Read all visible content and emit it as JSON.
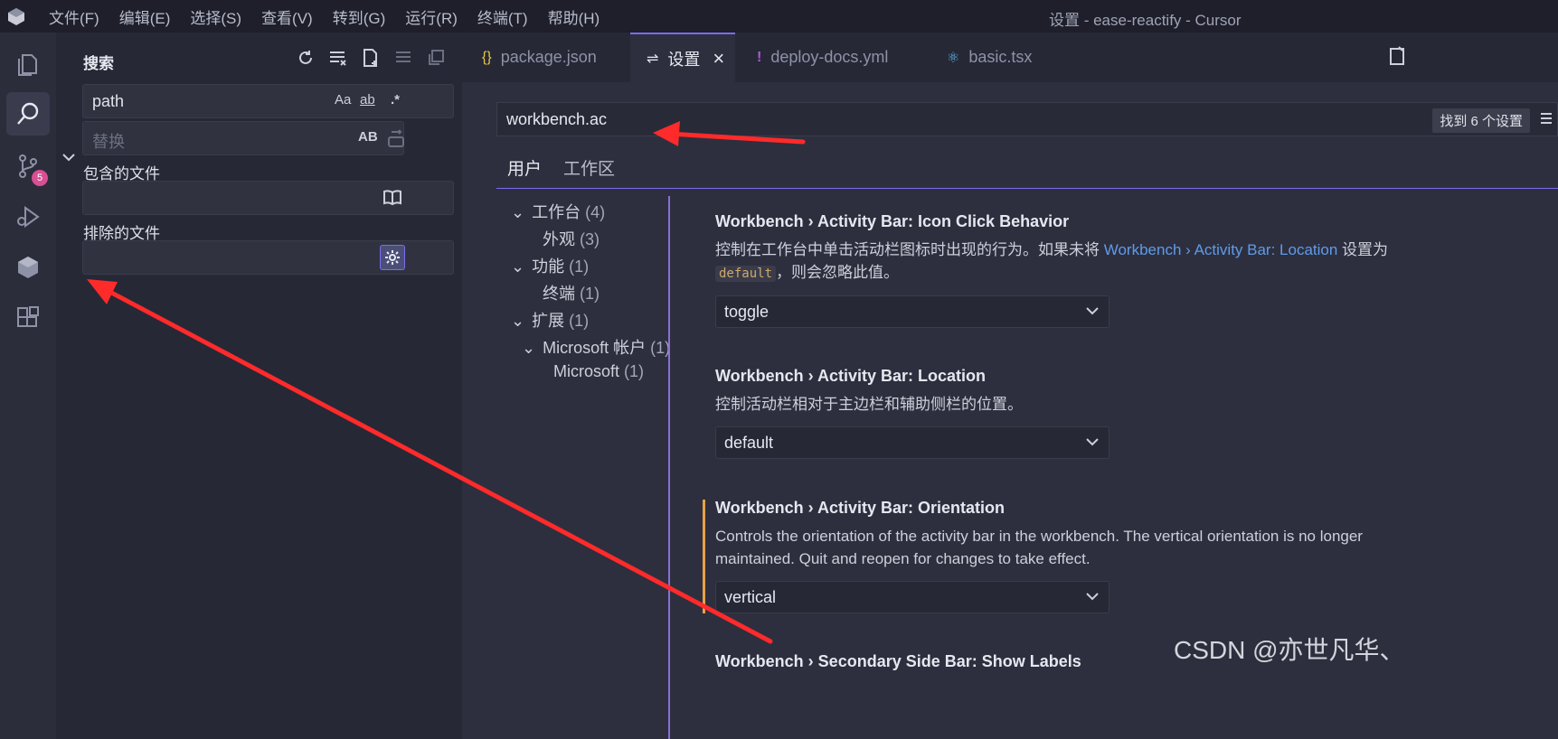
{
  "window": {
    "title": "设置 - ease-reactify - Cursor"
  },
  "menu": [
    "文件(F)",
    "编辑(E)",
    "选择(S)",
    "查看(V)",
    "转到(G)",
    "运行(R)",
    "终端(T)",
    "帮助(H)"
  ],
  "activity": {
    "scm_badge": "5"
  },
  "sidebar": {
    "title": "搜索",
    "search_value": "path",
    "opt_case": "Aa",
    "opt_word": "ab",
    "opt_regex": ".*",
    "replace_placeholder": "替换",
    "opt_preserve_case": "AB",
    "include_label": "包含的文件",
    "include_value": "",
    "exclude_label": "排除的文件",
    "exclude_value": "",
    "more": "···"
  },
  "tabs": [
    {
      "icon": "{}",
      "label": "package.json"
    },
    {
      "icon": "⇌",
      "label": "设置"
    },
    {
      "icon": "!",
      "label": "deploy-docs.yml"
    },
    {
      "icon": "⚛",
      "label": "basic.tsx"
    }
  ],
  "settings": {
    "search_value": "workbench.ac",
    "found": "找到 6 个设置",
    "scopes": [
      "用户",
      "工作区"
    ],
    "toc": [
      {
        "label": "工作台",
        "count": "(4)"
      },
      {
        "label": "外观",
        "count": "(3)"
      },
      {
        "label": "功能",
        "count": "(1)"
      },
      {
        "label": "终端",
        "count": "(1)"
      },
      {
        "label": "扩展",
        "count": "(1)"
      },
      {
        "label": "Microsoft 帐户",
        "count": "(1)"
      },
      {
        "label": "Microsoft",
        "count": "(1)"
      }
    ],
    "items": [
      {
        "title": "Workbench › Activity Bar: Icon Click Behavior",
        "desc_a": "控制在工作台中单击活动栏图标时出现的行为。如果未将 ",
        "desc_link": "Workbench › Activity Bar: Location",
        "desc_b": " 设置为",
        "desc_code": "default",
        "desc_c": "，则会忽略此值。",
        "value": "toggle"
      },
      {
        "title": "Workbench › Activity Bar: Location",
        "desc": "控制活动栏相对于主边栏和辅助侧栏的位置。",
        "value": "default"
      },
      {
        "title": "Workbench › Activity Bar: Orientation",
        "desc": "Controls the orientation of the activity bar in the workbench. The vertical orientation is no longer maintained. Quit and reopen for changes to take effect.",
        "value": "vertical"
      },
      {
        "title": "Workbench › Secondary Side Bar: Show Labels"
      }
    ]
  },
  "watermark": "CSDN @亦世凡华、",
  "colors": {
    "accent": "#7c6cf0",
    "annotation": "#ff2a2a",
    "modified": "#e6a14a"
  }
}
